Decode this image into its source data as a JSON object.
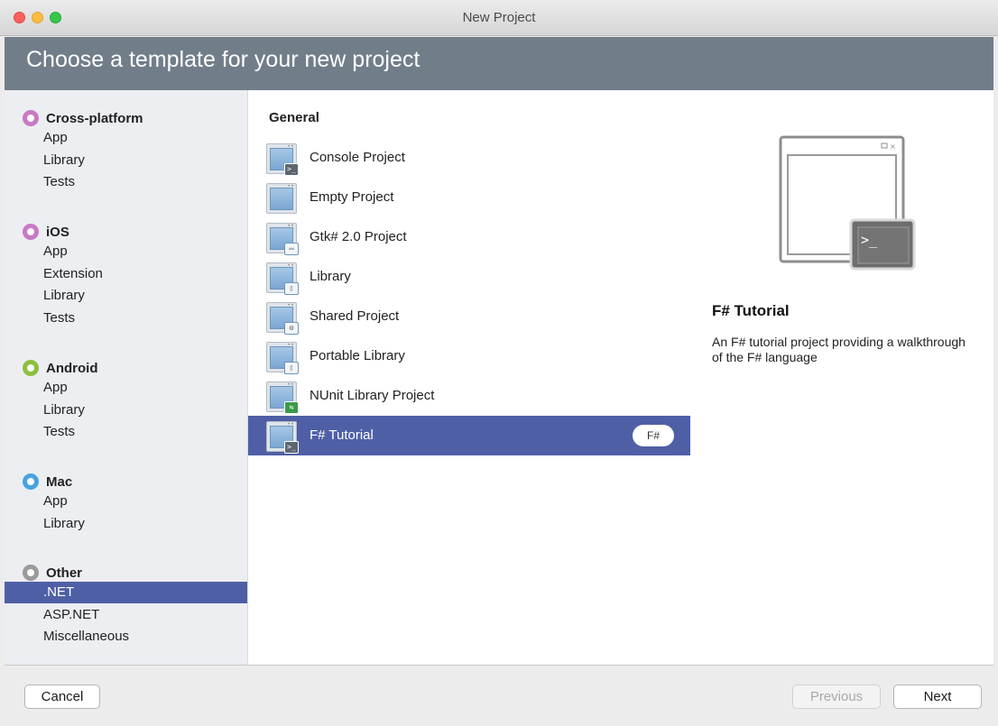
{
  "window": {
    "title": "New Project"
  },
  "header": {
    "title": "Choose a template for your new project"
  },
  "sidebar": {
    "categories": [
      {
        "label": "Cross-platform",
        "color": "#c879c5",
        "items": [
          "App",
          "Library",
          "Tests"
        ]
      },
      {
        "label": "iOS",
        "color": "#c879c5",
        "items": [
          "App",
          "Extension",
          "Library",
          "Tests"
        ]
      },
      {
        "label": "Android",
        "color": "#8dbf3f",
        "items": [
          "App",
          "Library",
          "Tests"
        ]
      },
      {
        "label": "Mac",
        "color": "#4aa3e0",
        "items": [
          "App",
          "Library"
        ]
      },
      {
        "label": "Other",
        "color": "#9a9a9a",
        "items": [
          ".NET",
          "ASP.NET",
          "Miscellaneous"
        ]
      }
    ],
    "selected_item": ".NET"
  },
  "templates": {
    "group_label": "General",
    "items": [
      {
        "label": "Console Project",
        "icon": "console-project-icon",
        "badge": "terminal"
      },
      {
        "label": "Empty Project",
        "icon": "empty-project-icon",
        "badge": ""
      },
      {
        "label": "Gtk# 2.0 Project",
        "icon": "gtk-project-icon",
        "badge": "window"
      },
      {
        "label": "Library",
        "icon": "library-icon",
        "badge": "book"
      },
      {
        "label": "Shared Project",
        "icon": "shared-project-icon",
        "badge": "shared"
      },
      {
        "label": "Portable Library",
        "icon": "portable-library-icon",
        "badge": "book"
      },
      {
        "label": "NUnit Library Project",
        "icon": "nunit-project-icon",
        "badge": "test"
      },
      {
        "label": "F# Tutorial",
        "icon": "fsharp-tutorial-icon",
        "badge": "terminal"
      }
    ],
    "selected": "F# Tutorial",
    "language_badge": "F#"
  },
  "detail": {
    "title": "F# Tutorial",
    "description": "An F# tutorial project providing a walkthrough of the F# language",
    "preview_icon": "terminal-window-preview-icon"
  },
  "footer": {
    "cancel_label": "Cancel",
    "previous_label": "Previous",
    "next_label": "Next"
  },
  "colors": {
    "header_bg": "#717e8a",
    "selection": "#4f5fa6",
    "sidebar_bg": "#eceef2"
  }
}
